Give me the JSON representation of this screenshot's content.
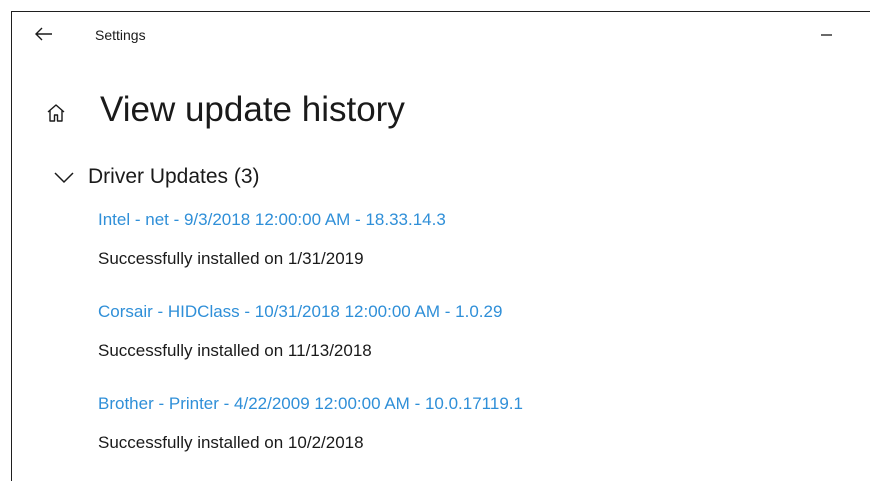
{
  "window": {
    "title": "Settings"
  },
  "icons": {
    "back": "back-arrow-icon",
    "minimize": "minimize-icon",
    "home": "home-icon",
    "chevron": "chevron-down-icon"
  },
  "colors": {
    "link": "#2f8fd8",
    "text": "#1a1a1a",
    "background": "#ffffff"
  },
  "page": {
    "title": "View update history"
  },
  "section": {
    "title": "Driver Updates (3)",
    "expanded": true,
    "items": [
      {
        "name": "Intel - net - 9/3/2018 12:00:00 AM - 18.33.14.3",
        "status": "Successfully installed on 1/31/2019"
      },
      {
        "name": "Corsair - HIDClass - 10/31/2018 12:00:00 AM - 1.0.29",
        "status": "Successfully installed on 11/13/2018"
      },
      {
        "name": "Brother - Printer - 4/22/2009 12:00:00 AM - 10.0.17119.1",
        "status": "Successfully installed on 10/2/2018"
      }
    ]
  }
}
